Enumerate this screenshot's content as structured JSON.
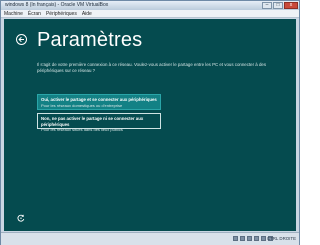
{
  "window": {
    "title": "windows 8 (In français) - Oracle VM VirtualBox",
    "minimize_glyph": "–",
    "maximize_glyph": "□",
    "close_glyph": "x"
  },
  "menubar": {
    "items": [
      {
        "label": "Machine"
      },
      {
        "label": "Écran"
      },
      {
        "label": "Périphériques"
      },
      {
        "label": "Aide"
      }
    ]
  },
  "setup": {
    "title": "Paramètres",
    "prompt": "Il s'agit de votre première connexion à ce réseau. Voulez-vous activer le partage entre les PC et vous connecter à des périphériques sur ce réseau ?",
    "options": [
      {
        "title": "Oui, activer le partage et se connecter aux périphériques",
        "subtitle": "Pour les réseaux domestiques ou d'entreprise",
        "selected": true
      },
      {
        "title": "Non, ne pas activer le partage ni se connecter aux périphériques",
        "subtitle": "Pour les réseaux situés dans des lieux publics",
        "selected": false
      }
    ],
    "icons": {
      "back": "back-arrow-icon",
      "ease_of_access": "ease-of-access-icon"
    }
  },
  "statusbar": {
    "host_key_label": "CTRL DROITE"
  },
  "colors": {
    "background": "#054b4f",
    "selected_option": "#138185",
    "text": "#ffffff"
  }
}
